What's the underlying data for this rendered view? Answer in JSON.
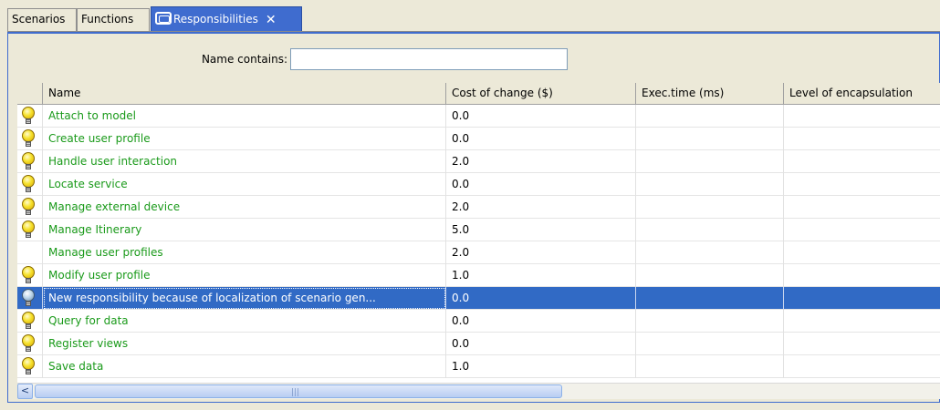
{
  "tabs": [
    {
      "label": "Scenarios",
      "active": false
    },
    {
      "label": "Functions",
      "active": false
    },
    {
      "label": "Responsibilities",
      "active": true,
      "close": "✕"
    }
  ],
  "filter": {
    "label": "Name contains:",
    "value": ""
  },
  "table": {
    "columns": [
      "",
      "Name",
      "Cost of change ($)",
      "Exec.time (ms)",
      "Level of encapsulation"
    ],
    "rows": [
      {
        "icon": "lightbulb-icon",
        "name": "Attach to model",
        "cost": "0.0",
        "exec": "",
        "level": ""
      },
      {
        "icon": "lightbulb-icon",
        "name": "Create user profile",
        "cost": "0.0",
        "exec": "",
        "level": ""
      },
      {
        "icon": "lightbulb-icon",
        "name": "Handle user interaction",
        "cost": "2.0",
        "exec": "",
        "level": ""
      },
      {
        "icon": "lightbulb-icon",
        "name": "Locate service",
        "cost": "0.0",
        "exec": "",
        "level": ""
      },
      {
        "icon": "lightbulb-icon",
        "name": "Manage external device",
        "cost": "2.0",
        "exec": "",
        "level": ""
      },
      {
        "icon": "lightbulb-icon",
        "name": "Manage Itinerary",
        "cost": "5.0",
        "exec": "",
        "level": ""
      },
      {
        "icon": "",
        "name": "Manage user profiles",
        "cost": "2.0",
        "exec": "",
        "level": ""
      },
      {
        "icon": "lightbulb-icon",
        "name": "Modify user profile",
        "cost": "1.0",
        "exec": "",
        "level": ""
      },
      {
        "icon": "lightbulb-dim-icon",
        "name": "New responsibility because of localization of scenario gen...",
        "cost": "0.0",
        "exec": "",
        "level": "",
        "selected": true
      },
      {
        "icon": "lightbulb-icon",
        "name": "Query for data",
        "cost": "0.0",
        "exec": "",
        "level": ""
      },
      {
        "icon": "lightbulb-icon",
        "name": "Register views",
        "cost": "0.0",
        "exec": "",
        "level": ""
      },
      {
        "icon": "lightbulb-icon",
        "name": "Save data",
        "cost": "1.0",
        "exec": "",
        "level": ""
      }
    ]
  },
  "scrollbar": {
    "left_arrow": "<",
    "grip": "|||"
  },
  "colors": {
    "accent": "#3f6ccf",
    "selection": "#316ac5",
    "name_text": "#1a9a1a"
  }
}
